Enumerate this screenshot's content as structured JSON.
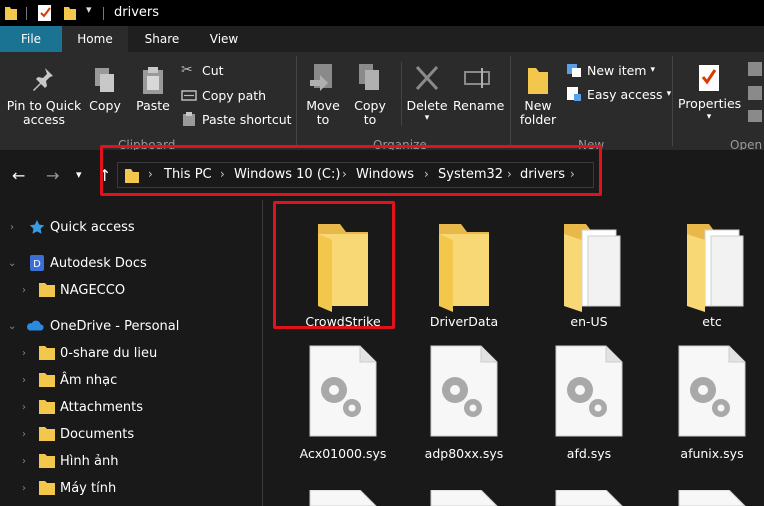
{
  "window": {
    "title": "drivers"
  },
  "tabs": [
    {
      "label": "File"
    },
    {
      "label": "Home"
    },
    {
      "label": "Share"
    },
    {
      "label": "View"
    }
  ],
  "ribbon": {
    "clipboard": {
      "pin": "Pin to Quick access",
      "copy": "Copy",
      "paste": "Paste",
      "cut": "Cut",
      "copy_path": "Copy path",
      "paste_shortcut": "Paste shortcut",
      "group": "Clipboard"
    },
    "organize": {
      "move_to": "Move to",
      "copy_to": "Copy to",
      "delete": "Delete",
      "rename": "Rename",
      "group": "Organize"
    },
    "new": {
      "new_folder": "New folder",
      "new_item": "New item",
      "easy_access": "Easy access",
      "group": "New"
    },
    "open": {
      "properties": "Properties",
      "group": "Open"
    }
  },
  "address": {
    "crumbs": [
      "This PC",
      "Windows 10 (C:)",
      "Windows",
      "System32",
      "drivers"
    ]
  },
  "nav_pane": {
    "items": [
      {
        "label": "Quick access"
      },
      {
        "label": "Autodesk Docs"
      },
      {
        "label": "NAGECCO"
      },
      {
        "label": "OneDrive - Personal"
      },
      {
        "label": "0-share du lieu"
      },
      {
        "label": "Âm nhạc"
      },
      {
        "label": "Attachments"
      },
      {
        "label": "Documents"
      },
      {
        "label": "Hình ảnh"
      },
      {
        "label": "Máy tính"
      }
    ]
  },
  "files": [
    {
      "name": "CrowdStrike",
      "kind": "folder"
    },
    {
      "name": "DriverData",
      "kind": "folder"
    },
    {
      "name": "en-US",
      "kind": "folder-docs"
    },
    {
      "name": "etc",
      "kind": "folder-docs"
    },
    {
      "name": "Acx01000.sys",
      "kind": "sys"
    },
    {
      "name": "adp80xx.sys",
      "kind": "sys"
    },
    {
      "name": "afd.sys",
      "kind": "sys"
    },
    {
      "name": "afunix.sys",
      "kind": "sys"
    }
  ],
  "colors": {
    "accent_file_tab": "#1a7392",
    "highlight_red": "#e1121b",
    "folder_yellow": "#f8d775",
    "ribbon_bg": "#2b2b2b",
    "window_bg": "#191919"
  }
}
